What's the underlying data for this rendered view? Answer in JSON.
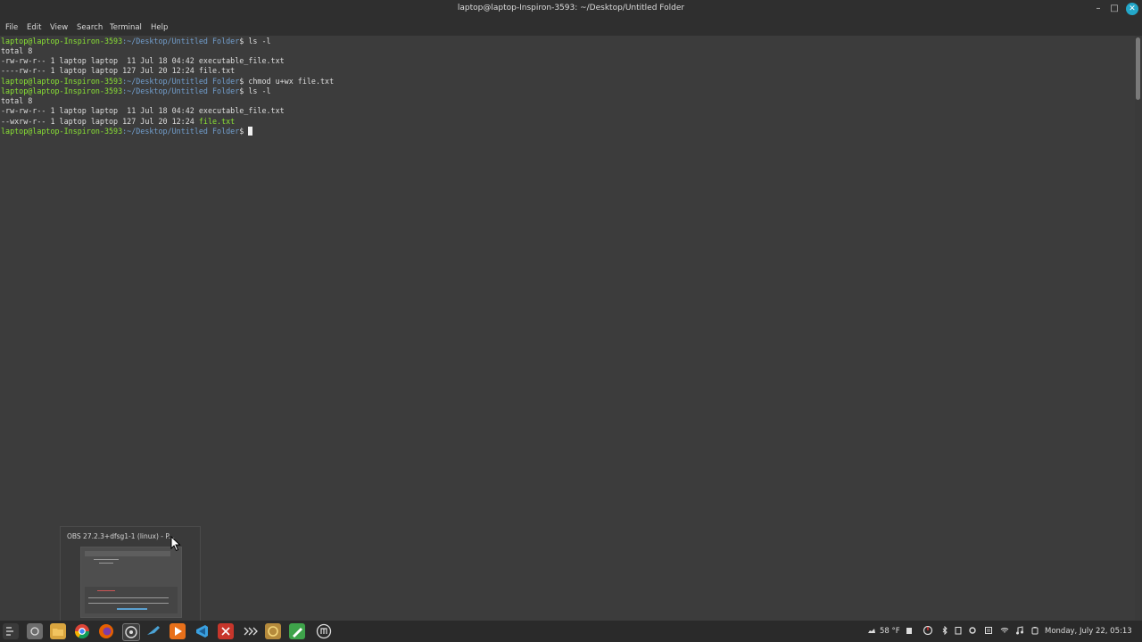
{
  "window": {
    "title": "laptop@laptop-Inspiron-3593: ~/Desktop/Untitled Folder",
    "controls": {
      "minimize": "–",
      "maximize": "□",
      "close": "✕"
    }
  },
  "menu": {
    "file": "File",
    "edit": "Edit",
    "view": "View",
    "search": "Search",
    "terminal": "Terminal",
    "help": "Help"
  },
  "terminal": {
    "prompt_user": "laptop@laptop-Inspiron-3593",
    "prompt_path": ":~/Desktop/Untitled Folder",
    "prompt_symbol": "$ ",
    "lines": [
      {
        "kind": "prompt",
        "cmd": "ls -l"
      },
      {
        "kind": "out",
        "text": "total 8"
      },
      {
        "kind": "out",
        "text": "-rw-rw-r-- 1 laptop laptop  11 Jul 18 04:42 executable_file.txt"
      },
      {
        "kind": "out",
        "text": "----rw-r-- 1 laptop laptop 127 Jul 20 12:24 file.txt"
      },
      {
        "kind": "prompt",
        "cmd": "chmod u+wx file.txt"
      },
      {
        "kind": "prompt",
        "cmd": "ls -l"
      },
      {
        "kind": "out",
        "text": "total 8"
      },
      {
        "kind": "out",
        "text": "-rw-rw-r-- 1 laptop laptop  11 Jul 18 04:42 executable_file.txt"
      },
      {
        "kind": "out_exec",
        "text": "--wxrw-r-- 1 laptop laptop 127 Jul 20 12:24 ",
        "exec": "file.txt"
      },
      {
        "kind": "prompt",
        "cmd": ""
      }
    ]
  },
  "preview": {
    "title": "OBS 27.2.3+dfsg1-1 (linux) - P..."
  },
  "taskbar": {
    "apps": [
      "menu-icon",
      "show-desktop-icon",
      "files-icon",
      "chrome-icon",
      "firefox-icon",
      "obs-icon",
      "steam-icon",
      "media-player-icon",
      "vscode-icon",
      "app-red-icon",
      "terminal-icon",
      "archive-icon",
      "text-editor-icon",
      "software-manager-icon"
    ],
    "weather": "58 °F",
    "clock": "Monday, July 22, 05:13"
  },
  "colors": {
    "accent_close": "#23a7c9",
    "prompt_user": "#8ae234",
    "prompt_path": "#729fcf",
    "background": "#3c3c3c"
  }
}
